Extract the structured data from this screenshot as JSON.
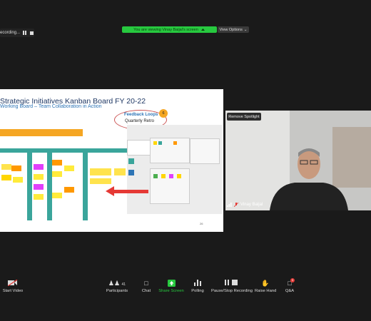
{
  "recording": {
    "label": "ecording...",
    "pause_icon": "pause-icon",
    "stop_icon": "stop-icon"
  },
  "banner": {
    "label": "You are viewing Vinay Baijal's screen",
    "view_options": "View Options"
  },
  "slide": {
    "title": "Strategic Initiatives Kanban Board FY 20-22",
    "subtitle": "Working Board – Team Collaboration in Action",
    "callout_title": "Feedback Loops",
    "callout_text": "Quarterly Retro",
    "badge": "6",
    "page_number": "26",
    "colors": {
      "teal": "#3aa59b",
      "orange": "#f5a623",
      "arrow": "#e53935",
      "title": "#1f3864"
    }
  },
  "video": {
    "remove_spotlight": "Remove Spotlight",
    "participant_name": "Vinay Baijal"
  },
  "toolbar": {
    "start_video": "Start Video",
    "participants": "Participants",
    "participants_count": "41",
    "chat": "Chat",
    "share_screen": "Share Screen",
    "polling": "Polling",
    "pause_recording": "Pause/Stop Recording",
    "raise_hand": "Raise Hand",
    "qa": "Q&A",
    "qa_badge": "1"
  }
}
